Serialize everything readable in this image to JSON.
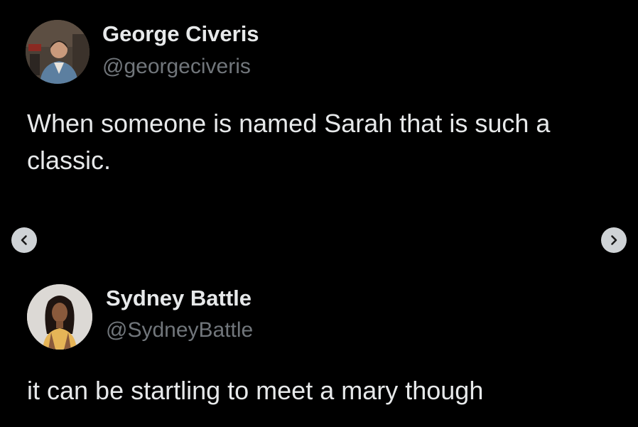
{
  "tweets": [
    {
      "name": "George Civeris",
      "handle": "@georgeciveris",
      "text": "When someone is named Sarah that is such a classic.",
      "avatar_icon": "profile-photo-man"
    },
    {
      "name": "Sydney Battle",
      "handle": "@SydneyBattle",
      "text": "it can be startling to meet a mary though",
      "avatar_icon": "profile-photo-woman"
    }
  ],
  "navigation": {
    "prev_icon": "chevron-left-icon",
    "next_icon": "chevron-right-icon"
  },
  "colors": {
    "background": "#000000",
    "primary_text": "#e7e9ea",
    "secondary_text": "#71767b",
    "nav_button": "#cfd3d6"
  }
}
